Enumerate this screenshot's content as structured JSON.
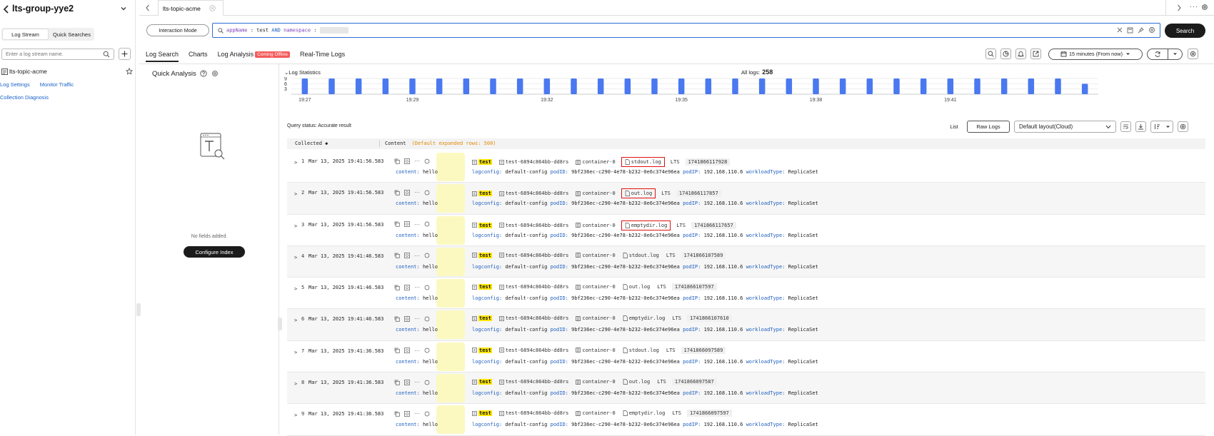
{
  "sidebar": {
    "title": "lts-group-yye2",
    "tabs": [
      {
        "label": "Log Stream",
        "active": true
      },
      {
        "label": "Quick Searches",
        "active": false
      }
    ],
    "search_placeholder": "Enter a log stream name.",
    "stream_name": "lts-topic-acme",
    "links": [
      "Log Settings",
      "Monitor Traffic"
    ],
    "diagnosis": "Collection Diagnosis"
  },
  "topbar": {
    "tab_title": "lts-topic-acme"
  },
  "query": {
    "mode_button": "Interaction Mode",
    "field1": "appName",
    "sep1": " : ",
    "value1": "test",
    "op": " AND ",
    "field2": "namespace",
    "sep2": " : ",
    "search_button": "Search"
  },
  "main_tabs": [
    {
      "label": "Log Search",
      "active": true
    },
    {
      "label": "Charts",
      "active": false
    },
    {
      "label": "Log Analysis",
      "active": false,
      "badge": "Coming Offline"
    },
    {
      "label": "Real-Time Logs",
      "active": false
    }
  ],
  "time_range": "15 minutes (From now)",
  "quick_analysis": {
    "title": "Quick Analysis",
    "empty_text": "No fields added.",
    "config_button": "Configure Index"
  },
  "stats": {
    "title": "Log Statistics",
    "all_logs_label": "All logs:",
    "all_logs_value": "258"
  },
  "chart_data": {
    "type": "bar",
    "y_ticks": [
      "9",
      "6",
      "3"
    ],
    "ylim": [
      0,
      9
    ],
    "x_labels": [
      "19:27",
      "19:29",
      "19:32",
      "19:35",
      "19:38",
      "19:41"
    ],
    "values": [
      9,
      9,
      9,
      9,
      9,
      9,
      9,
      9,
      9,
      9,
      9,
      9,
      9,
      9,
      9,
      9,
      9,
      9,
      9,
      9,
      9,
      9,
      9,
      9,
      9,
      9,
      9,
      9,
      9,
      6
    ]
  },
  "results": {
    "query_status_label": "Query status:",
    "query_status_value": "Accurate result",
    "list_button": "List",
    "raw_button": "Raw Logs",
    "layout": "Default layout(Cloud)",
    "col_collected": "Collected",
    "col_content": "Content",
    "col_content_hint": "(Default expanded rows: 500)"
  },
  "common": {
    "content_key": "content:",
    "content_val": "hello",
    "app": "test",
    "pod": "test-6894c864bb-dd8rs",
    "container": "container-0",
    "lts": "LTS",
    "logconfig_key": "logconfig:",
    "logconfig_val": "default-config",
    "podid_key": "podID:",
    "podid_val": "9bf236ec-c290-4e78-b232-0e6c374e96ea",
    "podip_key": "podIP:",
    "podip_val": "192.168.110.6",
    "wt_key": "workloadType:",
    "wt_val": "ReplicaSet"
  },
  "logs": [
    {
      "num": "1",
      "time": "Mar 13, 2025 19:41:56.583",
      "file": "stdout.log",
      "ts": "1741866117928",
      "highlight": true
    },
    {
      "num": "2",
      "time": "Mar 13, 2025 19:41:56.583",
      "file": "out.log",
      "ts": "1741866117857",
      "highlight": true
    },
    {
      "num": "3",
      "time": "Mar 13, 2025 19:41:56.583",
      "file": "emptydir.log",
      "ts": "1741866117657",
      "highlight": true
    },
    {
      "num": "4",
      "time": "Mar 13, 2025 19:41:46.583",
      "file": "stdout.log",
      "ts": "1741866107589",
      "highlight": false
    },
    {
      "num": "5",
      "time": "Mar 13, 2025 19:41:46.583",
      "file": "out.log",
      "ts": "1741866107597",
      "highlight": false
    },
    {
      "num": "6",
      "time": "Mar 13, 2025 19:41:46.583",
      "file": "emptydir.log",
      "ts": "1741866107610",
      "highlight": false
    },
    {
      "num": "7",
      "time": "Mar 13, 2025 19:41:36.583",
      "file": "stdout.log",
      "ts": "1741866097589",
      "highlight": false
    },
    {
      "num": "8",
      "time": "Mar 13, 2025 19:41:36.583",
      "file": "out.log",
      "ts": "1741866097587",
      "highlight": false
    },
    {
      "num": "9",
      "time": "Mar 13, 2025 19:41:36.583",
      "file": "emptydir.log",
      "ts": "1741866097597",
      "highlight": false
    }
  ]
}
